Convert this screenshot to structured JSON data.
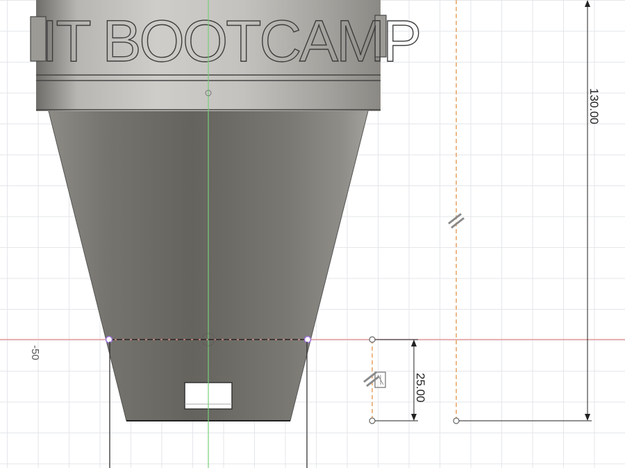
{
  "model": {
    "embossed_text": "IT BOOTCAMP"
  },
  "dimensions": {
    "height_total": "130.00",
    "height_small": "25.00",
    "axis_label": "-50"
  },
  "colors": {
    "grid": "#e3e6ea",
    "sketch_red_axis": "#e58a8a",
    "sketch_green_axis": "#76d07a",
    "construction_orange": "#e8a060",
    "body_gray": "#8a8780",
    "endpoint_purple": "#9a6fd6"
  },
  "icons": [
    "parallel-constraint-icon",
    "parallel-constraint-icon-2"
  ]
}
